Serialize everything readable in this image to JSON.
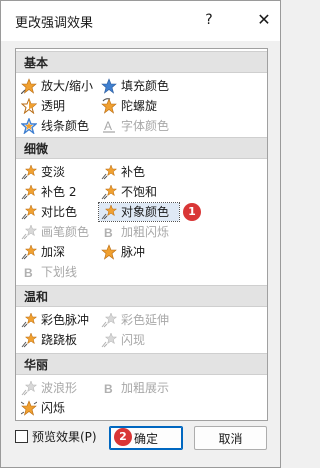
{
  "dialog": {
    "title": "更改强调效果",
    "help_label": "?",
    "close_label": "✕"
  },
  "groups": [
    {
      "name": "基本"
    },
    {
      "name": "细微"
    },
    {
      "name": "温和"
    },
    {
      "name": "华丽"
    }
  ],
  "items": {
    "basic": [
      "放大/缩小",
      "填充颜色",
      "透明",
      "陀螺旋",
      "线条颜色",
      "字体颜色"
    ],
    "subtle": [
      "变淡",
      "补色",
      "补色 2",
      "不饱和",
      "对比色",
      "对象颜色",
      "画笔颜色",
      "加粗闪烁",
      "加深",
      "脉冲",
      "下划线"
    ],
    "moderate": [
      "彩色脉冲",
      "彩色延伸",
      "跷跷板",
      "闪现"
    ],
    "exciting": [
      "波浪形",
      "加粗展示",
      "闪烁"
    ]
  },
  "badges": {
    "one": "1",
    "two": "2"
  },
  "footer": {
    "preview_label": "预览效果(P)",
    "ok_label": "确定",
    "cancel_label": "取消"
  },
  "colors": {
    "accent": "#d93636",
    "star_orange": "#f0a030",
    "star_blue": "#3f7fd0",
    "selection": "#dfe9f5"
  }
}
